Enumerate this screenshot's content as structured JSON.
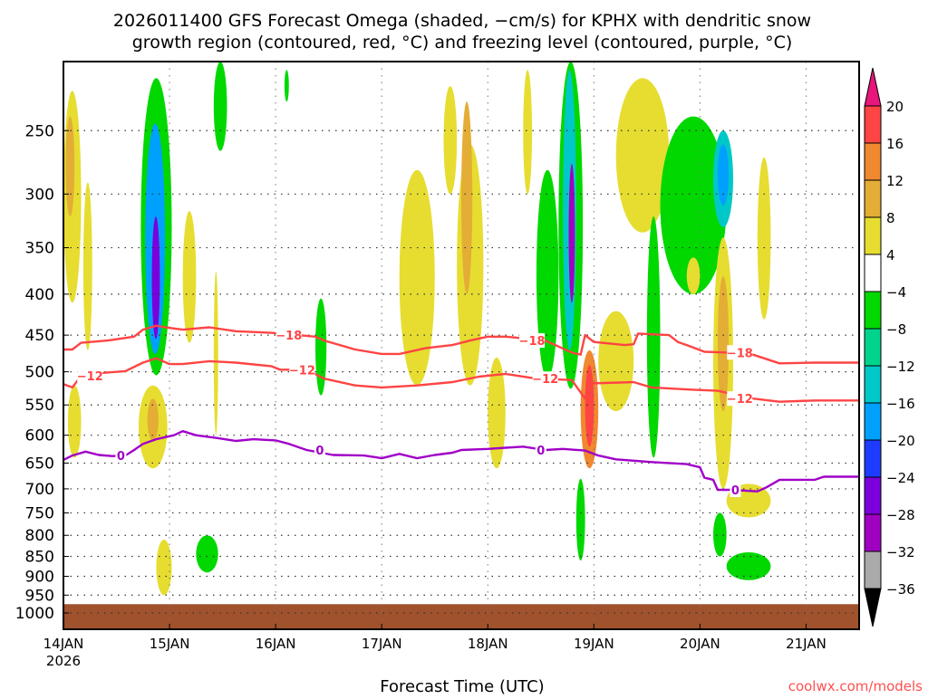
{
  "chart_data": {
    "type": "heatmap",
    "title_lines": [
      "2026011400 GFS Forecast Omega (shaded, −cm/s) for KPHX with dendritic snow",
      "growth region (contoured, red, °C) and freezing level (contoured, purple, °C)"
    ],
    "xlabel": "Forecast Time (UTC)",
    "credit": "coolwx.com/models",
    "x_unit": "forecast hour",
    "xlim": [
      0,
      180
    ],
    "x_ticks": [
      {
        "hour": 0,
        "label": "14JAN",
        "sub": "2026"
      },
      {
        "hour": 24,
        "label": "15JAN"
      },
      {
        "hour": 48,
        "label": "16JAN"
      },
      {
        "hour": 72,
        "label": "17JAN"
      },
      {
        "hour": 96,
        "label": "18JAN"
      },
      {
        "hour": 120,
        "label": "19JAN"
      },
      {
        "hour": 144,
        "label": "20JAN"
      },
      {
        "hour": 168,
        "label": "21JAN"
      }
    ],
    "y_unit": "hPa (log scale)",
    "ylim": [
      1048,
      205
    ],
    "y_ticks": [
      250,
      300,
      350,
      400,
      450,
      500,
      550,
      600,
      650,
      700,
      750,
      800,
      850,
      900,
      950,
      1000
    ],
    "grid": true,
    "ground_pressure": 975,
    "colorbar": {
      "labels": [
        "20",
        "16",
        "12",
        "8",
        "4",
        "−4",
        "−8",
        "−12",
        "−16",
        "−20",
        "−24",
        "−28",
        "−32",
        "−36"
      ],
      "top_extend_color": "#e8157a",
      "bottom_extend_color": "#000000",
      "bins": [
        {
          "min": 16,
          "max": 20,
          "color": "#ff4444"
        },
        {
          "min": 12,
          "max": 16,
          "color": "#f08830"
        },
        {
          "min": 8,
          "max": 12,
          "color": "#e4ad35"
        },
        {
          "min": 4,
          "max": 8,
          "color": "#e6dd30"
        },
        {
          "min": -4,
          "max": 4,
          "color": "#ffffff"
        },
        {
          "min": -8,
          "max": -4,
          "color": "#00d800"
        },
        {
          "min": -12,
          "max": -8,
          "color": "#00d48c"
        },
        {
          "min": -16,
          "max": -12,
          "color": "#00c8c8"
        },
        {
          "min": -20,
          "max": -16,
          "color": "#00a0ff"
        },
        {
          "min": -24,
          "max": -20,
          "color": "#1e3cff"
        },
        {
          "min": -28,
          "max": -24,
          "color": "#7a00dc"
        },
        {
          "min": -32,
          "max": -28,
          "color": "#a000c0"
        },
        {
          "min": -36,
          "max": -32,
          "color": "#aaaaaa"
        }
      ]
    },
    "omega_regions": [
      {
        "h": [
          0,
          4
        ],
        "p": [
          223,
          410
        ],
        "v": 6
      },
      {
        "h": [
          0.5,
          2.5
        ],
        "p": [
          240,
          320
        ],
        "v": 10
      },
      {
        "h": [
          4.5,
          6.5
        ],
        "p": [
          290,
          470
        ],
        "v": 6
      },
      {
        "h": [
          1,
          4
        ],
        "p": [
          520,
          640
        ],
        "v": 6
      },
      {
        "h": [
          17,
          23.5
        ],
        "p": [
          520,
          660
        ],
        "v": 6
      },
      {
        "h": [
          19,
          21.5
        ],
        "p": [
          540,
          610
        ],
        "v": 10
      },
      {
        "h": [
          21,
          24.5
        ],
        "p": [
          810,
          950
        ],
        "v": 6
      },
      {
        "h": [
          17.5,
          24.5
        ],
        "p": [
          215,
          505
        ],
        "v": -6
      },
      {
        "h": [
          18.5,
          23
        ],
        "p": [
          245,
          475
        ],
        "v": -18
      },
      {
        "h": [
          20,
          21.8
        ],
        "p": [
          320,
          455
        ],
        "v": -26
      },
      {
        "h": [
          27,
          30
        ],
        "p": [
          315,
          460
        ],
        "v": 6
      },
      {
        "h": [
          34,
          35
        ],
        "p": [
          375,
          600
        ],
        "v": 6
      },
      {
        "h": [
          34,
          37
        ],
        "p": [
          205,
          265
        ],
        "v": -6
      },
      {
        "h": [
          30,
          35
        ],
        "p": [
          800,
          890
        ],
        "v": -6
      },
      {
        "h": [
          57,
          59.5
        ],
        "p": [
          405,
          535
        ],
        "v": -6
      },
      {
        "h": [
          50,
          51
        ],
        "p": [
          210,
          230
        ],
        "v": -6
      },
      {
        "h": [
          76,
          84
        ],
        "p": [
          280,
          520
        ],
        "v": 6
      },
      {
        "h": [
          86,
          89
        ],
        "p": [
          220,
          300
        ],
        "v": 6
      },
      {
        "h": [
          89,
          95
        ],
        "p": [
          260,
          520
        ],
        "v": 6
      },
      {
        "h": [
          90,
          92.5
        ],
        "p": [
          230,
          400
        ],
        "v": 10
      },
      {
        "h": [
          96,
          100
        ],
        "p": [
          480,
          660
        ],
        "v": 6
      },
      {
        "h": [
          104,
          106
        ],
        "p": [
          210,
          300
        ],
        "v": 6
      },
      {
        "h": [
          107,
          112
        ],
        "p": [
          280,
          510
        ],
        "v": -6
      },
      {
        "h": [
          112,
          117.5
        ],
        "p": [
          205,
          525
        ],
        "v": -8
      },
      {
        "h": [
          113,
          116
        ],
        "p": [
          210,
          470
        ],
        "v": -14
      },
      {
        "h": [
          114.3,
          115.7
        ],
        "p": [
          275,
          410
        ],
        "v": -30
      },
      {
        "h": [
          117,
          121
        ],
        "p": [
          470,
          660
        ],
        "v": 12
      },
      {
        "h": [
          118,
          120
        ],
        "p": [
          490,
          620
        ],
        "v": 18
      },
      {
        "h": [
          121,
          129
        ],
        "p": [
          420,
          560
        ],
        "v": 6
      },
      {
        "h": [
          116,
          118
        ],
        "p": [
          680,
          860
        ],
        "v": -6
      },
      {
        "h": [
          125,
          137
        ],
        "p": [
          215,
          335
        ],
        "v": 6
      },
      {
        "h": [
          132,
          135
        ],
        "p": [
          320,
          640
        ],
        "v": -6
      },
      {
        "h": [
          135,
          150
        ],
        "p": [
          240,
          400
        ],
        "v": -6
      },
      {
        "h": [
          147,
          151.5
        ],
        "p": [
          250,
          330
        ],
        "v": -14
      },
      {
        "h": [
          148,
          150.5
        ],
        "p": [
          260,
          310
        ],
        "v": -18
      },
      {
        "h": [
          147,
          151.5
        ],
        "p": [
          340,
          700
        ],
        "v": 6
      },
      {
        "h": [
          148,
          150.5
        ],
        "p": [
          380,
          560
        ],
        "v": 10
      },
      {
        "h": [
          157,
          160
        ],
        "p": [
          270,
          430
        ],
        "v": 6
      },
      {
        "h": [
          150,
          160
        ],
        "p": [
          690,
          760
        ],
        "v": 6
      },
      {
        "h": [
          147,
          150
        ],
        "p": [
          750,
          850
        ],
        "v": -6
      },
      {
        "h": [
          150,
          160
        ],
        "p": [
          840,
          910
        ],
        "v": -6
      },
      {
        "h": [
          141,
          144
        ],
        "p": [
          360,
          400
        ],
        "v": 6
      }
    ],
    "contours": [
      {
        "name": "dgz-minus-18",
        "label": "−18",
        "color": "#ff4444",
        "label_hours": [
          51,
          106,
          153
        ],
        "points": [
          [
            0,
            469
          ],
          [
            2,
            469
          ],
          [
            4,
            460
          ],
          [
            10,
            457
          ],
          [
            16,
            452
          ],
          [
            18,
            443
          ],
          [
            21,
            438
          ],
          [
            23,
            440
          ],
          [
            27,
            443
          ],
          [
            33,
            440
          ],
          [
            39,
            445
          ],
          [
            47,
            447
          ],
          [
            53,
            450
          ],
          [
            57,
            452
          ],
          [
            59,
            457
          ],
          [
            66,
            469
          ],
          [
            72,
            475
          ],
          [
            76,
            475
          ],
          [
            82,
            467
          ],
          [
            88,
            463
          ],
          [
            92,
            457
          ],
          [
            96,
            452
          ],
          [
            100,
            452
          ],
          [
            102,
            453
          ],
          [
            109,
            457
          ],
          [
            112,
            465
          ],
          [
            115,
            473
          ],
          [
            117,
            476
          ],
          [
            118,
            450
          ],
          [
            120,
            459
          ],
          [
            127,
            463
          ],
          [
            129,
            462
          ],
          [
            130,
            448
          ],
          [
            137,
            450
          ],
          [
            139,
            459
          ],
          [
            141,
            463
          ],
          [
            145,
            472
          ],
          [
            150,
            473
          ],
          [
            156,
            476
          ],
          [
            162,
            488
          ],
          [
            170,
            487
          ],
          [
            180,
            487
          ]
        ]
      },
      {
        "name": "dgz-minus-12",
        "label": "−12",
        "color": "#ff4444",
        "label_hours": [
          6,
          54,
          109,
          153
        ],
        "points": [
          [
            0,
            518
          ],
          [
            2,
            523
          ],
          [
            4,
            506
          ],
          [
            8,
            502
          ],
          [
            14,
            499
          ],
          [
            18,
            487
          ],
          [
            21,
            481
          ],
          [
            24,
            489
          ],
          [
            27,
            489
          ],
          [
            33,
            485
          ],
          [
            39,
            487
          ],
          [
            47,
            492
          ],
          [
            49,
            497
          ],
          [
            55,
            497
          ],
          [
            59,
            510
          ],
          [
            66,
            520
          ],
          [
            72,
            523
          ],
          [
            80,
            520
          ],
          [
            88,
            515
          ],
          [
            94,
            507
          ],
          [
            100,
            503
          ],
          [
            107,
            510
          ],
          [
            115,
            512
          ],
          [
            118,
            540
          ],
          [
            119,
            517
          ],
          [
            129,
            515
          ],
          [
            133,
            523
          ],
          [
            141,
            526
          ],
          [
            148,
            528
          ],
          [
            156,
            540
          ],
          [
            162,
            545
          ],
          [
            170,
            543
          ],
          [
            180,
            543
          ]
        ]
      },
      {
        "name": "freezing-level-0",
        "label": "0",
        "color": "#a000c8",
        "label_hours": [
          13,
          58,
          108,
          152
        ],
        "points": [
          [
            0,
            644
          ],
          [
            2,
            636
          ],
          [
            5,
            629
          ],
          [
            8,
            635
          ],
          [
            11,
            637
          ],
          [
            14,
            636
          ],
          [
            16,
            626
          ],
          [
            18,
            615
          ],
          [
            21,
            607
          ],
          [
            25,
            600
          ],
          [
            27,
            593
          ],
          [
            30,
            600
          ],
          [
            35,
            605
          ],
          [
            39,
            610
          ],
          [
            43,
            607
          ],
          [
            48,
            609
          ],
          [
            51,
            615
          ],
          [
            55,
            626
          ],
          [
            61,
            635
          ],
          [
            68,
            636
          ],
          [
            72,
            641
          ],
          [
            76,
            633
          ],
          [
            80,
            641
          ],
          [
            84,
            635
          ],
          [
            88,
            631
          ],
          [
            90,
            626
          ],
          [
            96,
            624
          ],
          [
            100,
            622
          ],
          [
            104,
            620
          ],
          [
            109,
            626
          ],
          [
            113,
            624
          ],
          [
            118,
            627
          ],
          [
            121,
            636
          ],
          [
            125,
            643
          ],
          [
            133,
            648
          ],
          [
            141,
            652
          ],
          [
            144,
            658
          ],
          [
            145,
            678
          ],
          [
            147,
            682
          ],
          [
            148,
            702
          ],
          [
            151,
            702
          ],
          [
            157,
            705
          ],
          [
            159,
            697
          ],
          [
            162,
            682
          ],
          [
            170,
            682
          ],
          [
            172,
            676
          ],
          [
            180,
            676
          ]
        ]
      }
    ]
  }
}
